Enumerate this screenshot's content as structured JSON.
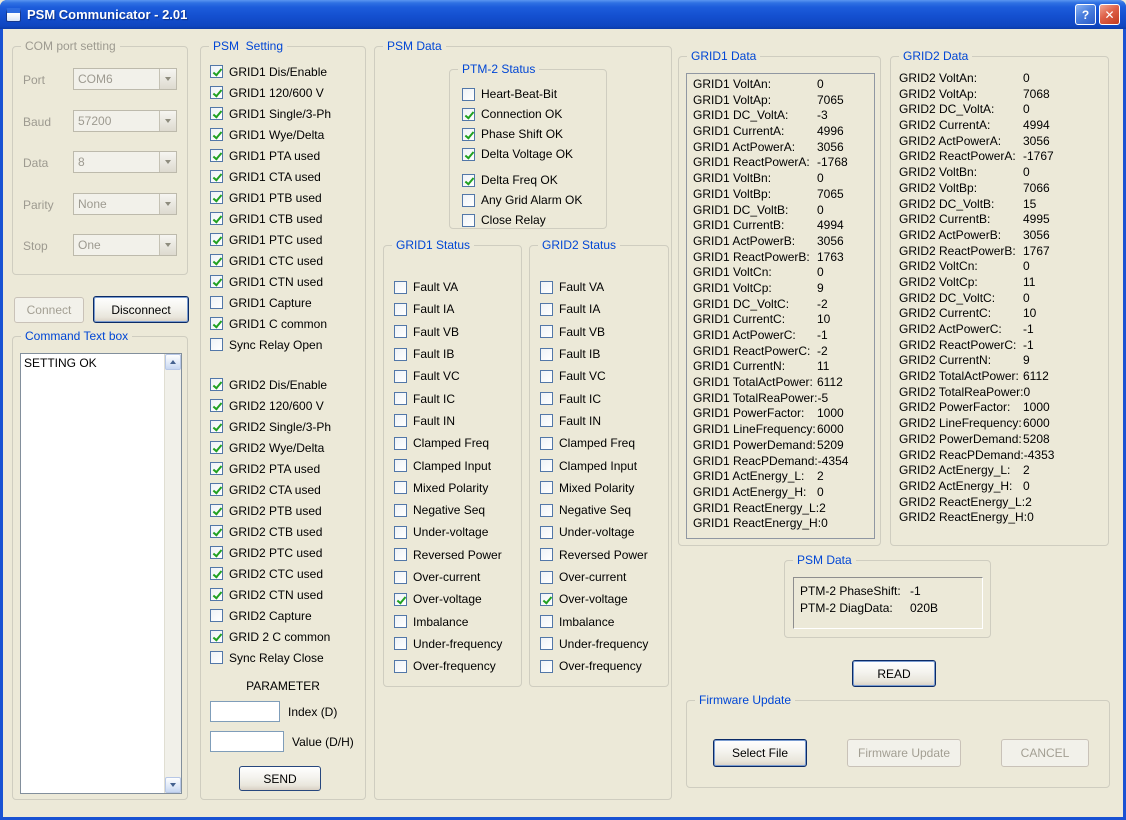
{
  "window": {
    "title": "PSM Communicator - 2.01",
    "help_glyph": "?",
    "close_glyph": "✕"
  },
  "colors": {
    "titlebar_top": "#5A96F0",
    "titlebar_bottom": "#0C3BA8",
    "frame_blue": "#1952D3",
    "background": "#ECE9D8",
    "groupbox_caption_blue": "#0046D5",
    "check_green": "#21A121",
    "disabled_text": "#9D9A90"
  },
  "com_port": {
    "title": "COM port setting",
    "rows": [
      {
        "label": "Port",
        "value": "COM6"
      },
      {
        "label": "Baud",
        "value": "57200"
      },
      {
        "label": "Data",
        "value": "8"
      },
      {
        "label": "Parity",
        "value": "None"
      },
      {
        "label": "Stop",
        "value": "One"
      }
    ]
  },
  "connection": {
    "connect_label": "Connect",
    "disconnect_label": "Disconnect"
  },
  "command_box": {
    "title": "Command Text box",
    "text": "SETTING OK"
  },
  "psm_setting": {
    "title": "PSM  Setting",
    "checkboxes": [
      {
        "label": "GRID1 Dis/Enable",
        "state": "checked"
      },
      {
        "label": "GRID1 120/600 V",
        "state": "checked"
      },
      {
        "label": "GRID1 Single/3-Ph",
        "state": "checked"
      },
      {
        "label": "GRID1 Wye/Delta",
        "state": "checked"
      },
      {
        "label": "GRID1 PTA used",
        "state": "checked"
      },
      {
        "label": "GRID1 CTA used",
        "state": "checked"
      },
      {
        "label": "GRID1 PTB used",
        "state": "checked"
      },
      {
        "label": "GRID1 CTB used",
        "state": "checked"
      },
      {
        "label": "GRID1 PTC used",
        "state": "checked"
      },
      {
        "label": "GRID1 CTC used",
        "state": "checked"
      },
      {
        "label": "GRID1 CTN used",
        "state": "checked"
      },
      {
        "label": "GRID1 Capture",
        "state": "unchecked"
      },
      {
        "label": "GRID1 C common",
        "state": "checked"
      },
      {
        "label": "Sync Relay Open",
        "state": "unchecked"
      },
      {
        "label": "GRID2 Dis/Enable",
        "state": "checked",
        "cls": "gap-lg"
      },
      {
        "label": "GRID2 120/600 V",
        "state": "checked"
      },
      {
        "label": "GRID2 Single/3-Ph",
        "state": "checked"
      },
      {
        "label": "GRID2 Wye/Delta",
        "state": "checked"
      },
      {
        "label": "GRID2 PTA used",
        "state": "checked"
      },
      {
        "label": "GRID2 CTA used",
        "state": "checked"
      },
      {
        "label": "GRID2 PTB used",
        "state": "checked"
      },
      {
        "label": "GRID2 CTB used",
        "state": "checked"
      },
      {
        "label": "GRID2 PTC used",
        "state": "checked"
      },
      {
        "label": "GRID2 CTC used",
        "state": "checked"
      },
      {
        "label": "GRID2 CTN used",
        "state": "checked"
      },
      {
        "label": "GRID2 Capture",
        "state": "unchecked"
      },
      {
        "label": "GRID 2 C common",
        "state": "checked"
      },
      {
        "label": "Sync Relay Close",
        "state": "unchecked"
      }
    ],
    "parameter_title": "PARAMETER",
    "index_label": "Index (D)",
    "index_value": "",
    "value_label": "Value (D/H)",
    "value_value": "",
    "send_label": "SEND"
  },
  "psm_data_group": {
    "title": "PSM Data",
    "ptm2": {
      "title": "PTM-2 Status",
      "checkboxes": [
        {
          "label": "Heart-Beat-Bit",
          "state": "unchecked"
        },
        {
          "label": "Connection OK",
          "state": "checked"
        },
        {
          "label": "Phase Shift OK",
          "state": "checked"
        },
        {
          "label": "Delta Voltage OK",
          "state": "checked"
        },
        {
          "label": "Delta Freq OK",
          "state": "checked",
          "cls": "gap-sm"
        },
        {
          "label": "Any Grid Alarm OK",
          "state": "unchecked"
        },
        {
          "label": "Close Relay",
          "state": "unchecked"
        }
      ]
    },
    "grid1_status": {
      "title": "GRID1 Status",
      "checkboxes": [
        {
          "label": "Fault VA",
          "state": "unchecked"
        },
        {
          "label": "Fault IA",
          "state": "unchecked"
        },
        {
          "label": "Fault VB",
          "state": "unchecked"
        },
        {
          "label": "Fault IB",
          "state": "unchecked"
        },
        {
          "label": "Fault VC",
          "state": "unchecked"
        },
        {
          "label": "Fault IC",
          "state": "unchecked"
        },
        {
          "label": "Fault IN",
          "state": "unchecked"
        },
        {
          "label": "Clamped Freq",
          "state": "unchecked"
        },
        {
          "label": "Clamped Input",
          "state": "unchecked"
        },
        {
          "label": "Mixed Polarity",
          "state": "unchecked"
        },
        {
          "label": "Negative Seq",
          "state": "unchecked"
        },
        {
          "label": "Under-voltage",
          "state": "unchecked"
        },
        {
          "label": "Reversed Power",
          "state": "unchecked"
        },
        {
          "label": "Over-current",
          "state": "unchecked"
        },
        {
          "label": "Over-voltage",
          "state": "checked"
        },
        {
          "label": "Imbalance",
          "state": "unchecked"
        },
        {
          "label": "Under-frequency",
          "state": "unchecked"
        },
        {
          "label": "Over-frequency",
          "state": "unchecked"
        }
      ]
    },
    "grid2_status": {
      "title": "GRID2 Status",
      "checkboxes": [
        {
          "label": "Fault VA",
          "state": "unchecked"
        },
        {
          "label": "Fault IA",
          "state": "unchecked"
        },
        {
          "label": "Fault VB",
          "state": "unchecked"
        },
        {
          "label": "Fault IB",
          "state": "unchecked"
        },
        {
          "label": "Fault VC",
          "state": "unchecked"
        },
        {
          "label": "Fault IC",
          "state": "unchecked"
        },
        {
          "label": "Fault IN",
          "state": "unchecked"
        },
        {
          "label": "Clamped Freq",
          "state": "unchecked"
        },
        {
          "label": "Clamped Input",
          "state": "unchecked"
        },
        {
          "label": "Mixed Polarity",
          "state": "unchecked"
        },
        {
          "label": "Negative Seq",
          "state": "unchecked"
        },
        {
          "label": "Under-voltage",
          "state": "unchecked"
        },
        {
          "label": "Reversed Power",
          "state": "unchecked"
        },
        {
          "label": "Over-current",
          "state": "unchecked"
        },
        {
          "label": "Over-voltage",
          "state": "checked"
        },
        {
          "label": "Imbalance",
          "state": "unchecked"
        },
        {
          "label": "Under-frequency",
          "state": "unchecked"
        },
        {
          "label": "Over-frequency",
          "state": "unchecked"
        }
      ]
    }
  },
  "grid1_data": {
    "title": "GRID1 Data",
    "lines": [
      {
        "label": "GRID1 VoltAn:",
        "value": "0"
      },
      {
        "label": "GRID1 VoltAp:",
        "value": "7065"
      },
      {
        "label": "GRID1 DC_VoltA:",
        "value": "-3"
      },
      {
        "label": "GRID1 CurrentA:",
        "value": "4996"
      },
      {
        "label": "GRID1 ActPowerA:",
        "value": "3056"
      },
      {
        "label": "GRID1 ReactPowerA:",
        "value": "-1768"
      },
      {
        "label": "GRID1 VoltBn:",
        "value": "0"
      },
      {
        "label": "GRID1 VoltBp:",
        "value": "7065"
      },
      {
        "label": "GRID1 DC_VoltB:",
        "value": "0"
      },
      {
        "label": "GRID1 CurrentB:",
        "value": "4994"
      },
      {
        "label": "GRID1 ActPowerB:",
        "value": "3056"
      },
      {
        "label": "GRID1 ReactPowerB:",
        "value": "1763"
      },
      {
        "label": "GRID1 VoltCn:",
        "value": "0"
      },
      {
        "label": "GRID1 VoltCp:",
        "value": "9"
      },
      {
        "label": "GRID1 DC_VoltC:",
        "value": "-2"
      },
      {
        "label": "GRID1 CurrentC:",
        "value": "10"
      },
      {
        "label": "GRID1 ActPowerC:",
        "value": "-1"
      },
      {
        "label": "GRID1 ReactPowerC:",
        "value": "-2"
      },
      {
        "label": "GRID1 CurrentN:",
        "value": "11"
      },
      {
        "label": "GRID1 TotalActPower:",
        "value": "6112"
      },
      {
        "label": "GRID1 TotalReaPower:",
        "value": "-5"
      },
      {
        "label": "GRID1 PowerFactor:",
        "value": "1000"
      },
      {
        "label": "GRID1 LineFrequency:",
        "value": "6000"
      },
      {
        "label": "GRID1 PowerDemand:",
        "value": "5209"
      },
      {
        "label": "GRID1 ReacPDemand:",
        "value": "-4354"
      },
      {
        "label": "GRID1 ActEnergy_L:",
        "value": "2"
      },
      {
        "label": "GRID1 ActEnergy_H:",
        "value": "0"
      },
      {
        "label": "GRID1 ReactEnergy_L:",
        "value": "2"
      },
      {
        "label": "GRID1 ReactEnergy_H:",
        "value": "0"
      }
    ]
  },
  "grid2_data": {
    "title": "GRID2 Data",
    "lines": [
      {
        "label": "GRID2 VoltAn:",
        "value": "0"
      },
      {
        "label": "GRID2 VoltAp:",
        "value": "7068"
      },
      {
        "label": "GRID2 DC_VoltA:",
        "value": "0"
      },
      {
        "label": "GRID2 CurrentA:",
        "value": "4994"
      },
      {
        "label": "GRID2 ActPowerA:",
        "value": "3056"
      },
      {
        "label": "GRID2 ReactPowerA:",
        "value": "-1767"
      },
      {
        "label": "GRID2 VoltBn:",
        "value": "0"
      },
      {
        "label": "GRID2 VoltBp:",
        "value": "7066"
      },
      {
        "label": "GRID2 DC_VoltB:",
        "value": "15"
      },
      {
        "label": "GRID2 CurrentB:",
        "value": "4995"
      },
      {
        "label": "GRID2 ActPowerB:",
        "value": "3056"
      },
      {
        "label": "GRID2 ReactPowerB:",
        "value": "1767"
      },
      {
        "label": "GRID2 VoltCn:",
        "value": "0"
      },
      {
        "label": "GRID2 VoltCp:",
        "value": "11"
      },
      {
        "label": "GRID2 DC_VoltC:",
        "value": "0"
      },
      {
        "label": "GRID2 CurrentC:",
        "value": "10"
      },
      {
        "label": "GRID2 ActPowerC:",
        "value": "-1"
      },
      {
        "label": "GRID2 ReactPowerC:",
        "value": "-1"
      },
      {
        "label": "GRID2 CurrentN:",
        "value": "9"
      },
      {
        "label": "GRID2 TotalActPower:",
        "value": "6112"
      },
      {
        "label": "GRID2 TotalReaPower:",
        "value": "0"
      },
      {
        "label": "GRID2 PowerFactor:",
        "value": "1000"
      },
      {
        "label": "GRID2 LineFrequency:",
        "value": "6000"
      },
      {
        "label": "GRID2 PowerDemand:",
        "value": "5208"
      },
      {
        "label": "GRID2 ReacPDemand:",
        "value": "-4353"
      },
      {
        "label": "GRID2 ActEnergy_L:",
        "value": "2"
      },
      {
        "label": "GRID2 ActEnergy_H:",
        "value": "0"
      },
      {
        "label": "GRID2 ReactEnergy_L:",
        "value": "2"
      },
      {
        "label": "GRID2 ReactEnergy_H:",
        "value": "0"
      }
    ]
  },
  "psm_data_small": {
    "title": "PSM Data",
    "lines": [
      {
        "label": "PTM-2 PhaseShift:",
        "value": "-1"
      },
      {
        "label": "PTM-2 DiagData:",
        "value": "020B"
      }
    ],
    "read_label": "READ"
  },
  "firmware": {
    "title": "Firmware Update",
    "select_file_label": "Select File",
    "firmware_update_label": "Firmware Update",
    "cancel_label": "CANCEL"
  }
}
